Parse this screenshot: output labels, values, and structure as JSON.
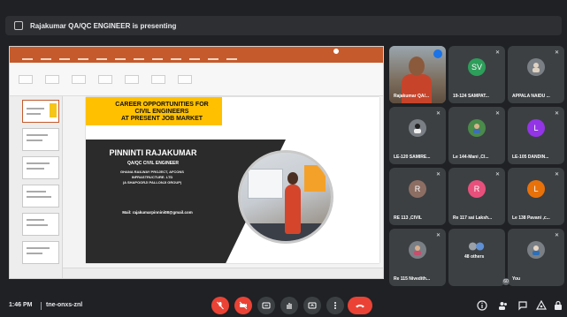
{
  "banner": {
    "text": "Rajakumar QA/QC ENGINEER is presenting"
  },
  "slide": {
    "title_line1": "CAREER OPPORTUNITIES FOR",
    "title_line2": "CIVIL ENGINEERS",
    "title_line3": "AT PRESENT JOB MARKET",
    "name": "PINNINTI RAJAKUMAR",
    "role": "QA/QC CIVIL ENGINEER",
    "project_line1": "GHANA RAILWAY PROJECT, AFCONS",
    "project_line2": "INFRASTRUCTURE. LTD",
    "project_line3": "(A SHAPOORJI PALLONJI GROUP)",
    "email": "Mail: rajakumarpinnini08@gmail.com"
  },
  "participants": [
    {
      "label": "Rajakumar QA/...",
      "initial": "",
      "color": ""
    },
    {
      "label": "19-124 SAMPAT...",
      "initial": "SV",
      "color": "#2e9e5b"
    },
    {
      "label": "APPALA NAIDU ...",
      "initial": "",
      "color": "#5f6368"
    },
    {
      "label": "LE-120 SAMIRE...",
      "initial": "",
      "color": "#5f6368"
    },
    {
      "label": "Le 144-Mani ,Cl...",
      "initial": "",
      "color": "#4a8a4a"
    },
    {
      "label": "LE-105 DANDIN...",
      "initial": "L",
      "color": "#9334e6"
    },
    {
      "label": "RE 113 ,CIVIL",
      "initial": "R",
      "color": "#8d6e63"
    },
    {
      "label": "Re 117 sai Laksh...",
      "initial": "R",
      "color": "#e8507c"
    },
    {
      "label": "Le 138 Pavani ,c...",
      "initial": "L",
      "color": "#e8710a"
    },
    {
      "label": "Re 115 Nivedith...",
      "initial": "",
      "color": "#5f6368"
    },
    {
      "label": "48 others",
      "initial": "",
      "color": "#5f6368"
    },
    {
      "label": "You",
      "initial": "",
      "color": "#5f6368"
    }
  ],
  "bottom": {
    "time": "1:46 PM",
    "meeting_code": "tne-onxs-znl",
    "people_count": "60"
  },
  "icons": {
    "mic_off": "mic-off-icon",
    "cam_off": "camera-off-icon",
    "captions": "captions-icon",
    "raise_hand": "raise-hand-icon",
    "present": "present-screen-icon",
    "more": "more-options-icon",
    "end_call": "end-call-icon",
    "info": "info-icon",
    "people": "people-icon",
    "chat": "chat-icon",
    "activities": "activities-icon",
    "lock": "host-controls-icon"
  }
}
